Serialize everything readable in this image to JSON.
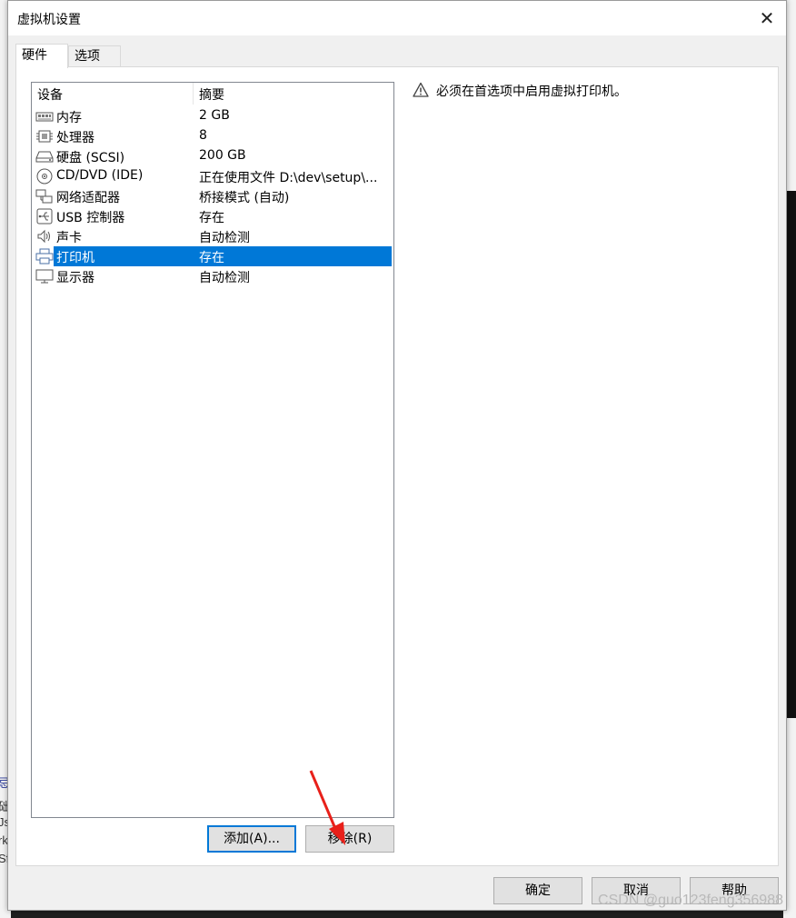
{
  "window": {
    "title": "虚拟机设置",
    "close_glyph": "✕"
  },
  "tabs": [
    {
      "label": "硬件",
      "active": true
    },
    {
      "label": "选项",
      "active": false
    }
  ],
  "device_list": {
    "columns": [
      "设备",
      "摘要"
    ],
    "rows": [
      {
        "name": "内存",
        "summary": "2 GB",
        "icon": "memory-icon"
      },
      {
        "name": "处理器",
        "summary": "8",
        "icon": "processor-icon"
      },
      {
        "name": "硬盘 (SCSI)",
        "summary": "200 GB",
        "icon": "hard-disk-icon"
      },
      {
        "name": "CD/DVD (IDE)",
        "summary": "正在使用文件 D:\\dev\\setup\\...",
        "icon": "cd-dvd-icon"
      },
      {
        "name": "网络适配器",
        "summary": "桥接模式 (自动)",
        "icon": "network-adapter-icon"
      },
      {
        "name": "USB 控制器",
        "summary": "存在",
        "icon": "usb-icon"
      },
      {
        "name": "声卡",
        "summary": "自动检测",
        "icon": "sound-card-icon"
      },
      {
        "name": "打印机",
        "summary": "存在",
        "icon": "printer-icon",
        "selected": true
      },
      {
        "name": "显示器",
        "summary": "自动检测",
        "icon": "display-icon"
      }
    ]
  },
  "device_buttons": {
    "add_label": "添加(A)...",
    "remove_label": "移除(R)"
  },
  "notice": {
    "text": "必须在首选项中启用虚拟打印机。",
    "icon": "warning-icon"
  },
  "footer_buttons": {
    "ok_label": "确定",
    "cancel_label": "取消",
    "help_label": "帮助"
  },
  "background": {
    "left_fragments": [
      "忌",
      "础",
      "Js",
      "rk",
      "Sf"
    ]
  },
  "watermark": "CSDN @guo123feng356988",
  "colors": {
    "selection": "#0078d7",
    "arrow": "#e8201a"
  }
}
